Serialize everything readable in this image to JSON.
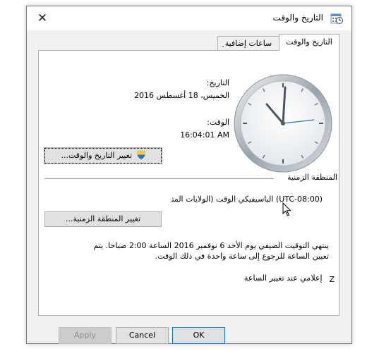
{
  "window": {
    "title": "التاريخ والوقت",
    "close_glyph": "✕"
  },
  "tabs": [
    {
      "label": "التاريخ والوقت",
      "active": true
    },
    {
      "label": "ساعات إضافية",
      "active": false
    }
  ],
  "date": {
    "label": "التاريخ:",
    "value": "الخميس، 18 أغسطس 2016"
  },
  "time": {
    "label": "الوقت:",
    "value": "16:04:01 AM"
  },
  "buttons": {
    "change_date_time": "تغيير التاريخ والوقت...",
    "change_time_zone": "تغيير المنطقة الزمنية...",
    "ok": "OK",
    "cancel": "Cancel",
    "apply": "Apply"
  },
  "time_zone": {
    "section_label": "المنطقة الزمنية",
    "value": "(UTC-08:00) الباسيفيكي الوقت (الولايات المتحدة وكندا)"
  },
  "dst_info": "ينتهي التوقيت الصيفي يوم الأحد 6 نوفمبر 2016 الساعة 2:00 صباحا. يتم تعيين الساعة للرجوع إلى ساعة واحدة في ذلك الوقت.",
  "notify_checkbox": {
    "label": "إعلامي عند تغيير الساعة",
    "checked": false
  },
  "colors": {
    "tz_highlight": "#f4b57a",
    "ok_border": "#0078d7"
  },
  "icons": [
    "date-time-icon",
    "close-icon",
    "shield-icon",
    "clock-icon",
    "mouse-pointer-icon"
  ]
}
